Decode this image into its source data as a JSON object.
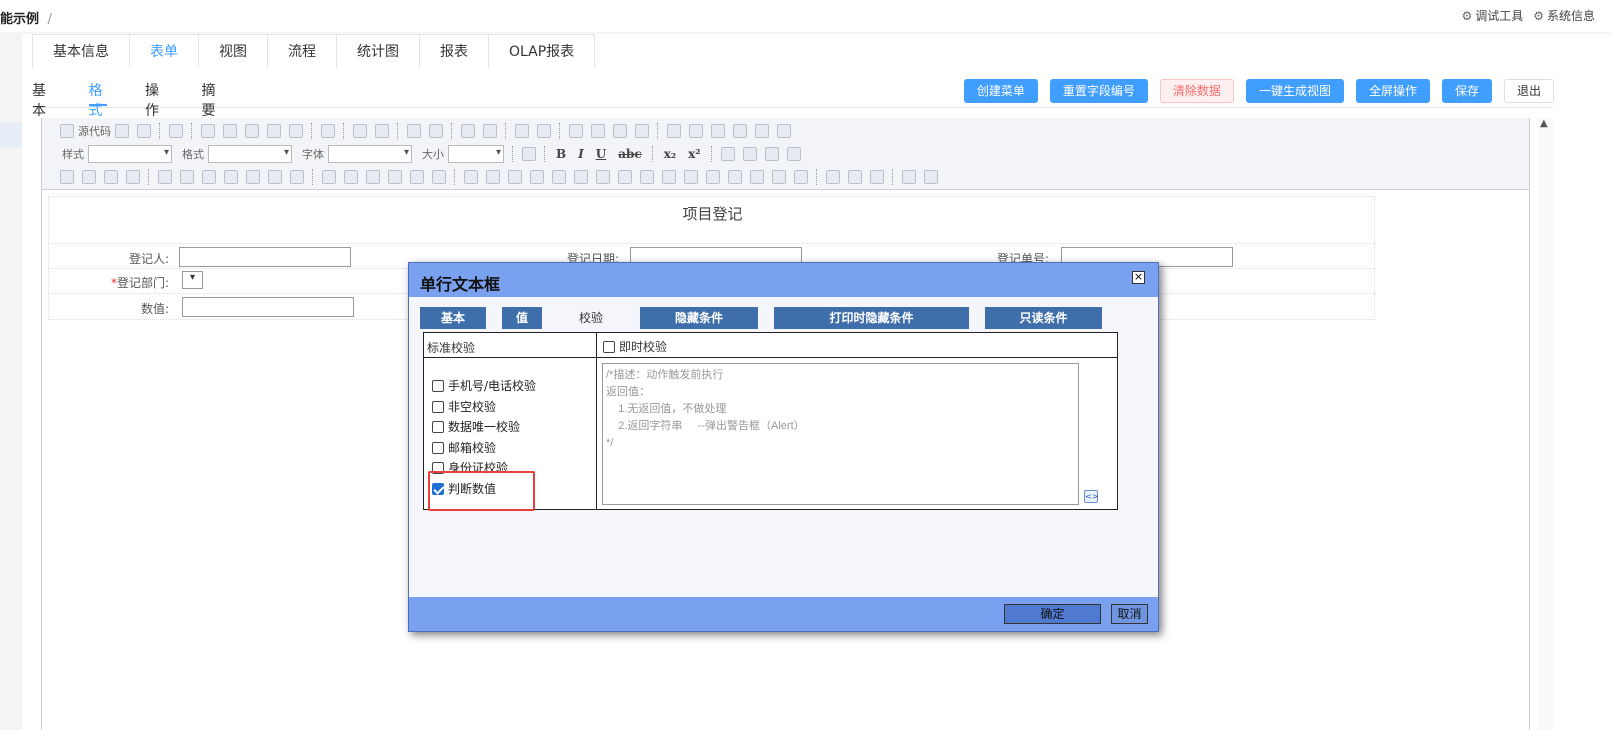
{
  "header": {
    "breadcrumb": "能示例",
    "breadcrumb_sep": "/",
    "debug_tool": "调试工具",
    "system_info": "系统信息"
  },
  "main_tabs": [
    "基本信息",
    "表单",
    "视图",
    "流程",
    "统计图",
    "报表",
    "OLAP报表"
  ],
  "main_tabs_active": "表单",
  "sub_tabs": [
    "基本",
    "格式",
    "操作",
    "摘要"
  ],
  "sub_tabs_active": "格式",
  "actions": {
    "create_menu": "创建菜单",
    "reset_field_no": "重置字段编号",
    "clear_data": "清除数据",
    "gen_view": "一键生成视图",
    "fullscreen": "全屏操作",
    "save": "保存",
    "exit": "退出"
  },
  "toolbar": {
    "source_code": "源代码",
    "style_label": "样式",
    "format_label": "格式",
    "font_label": "字体",
    "size_label": "大小"
  },
  "form": {
    "title": "项目登记",
    "registrant_label": "登记人:",
    "date_label": "登记日期:",
    "reg_no_label": "登记单号:",
    "dept_label": "登记部门:",
    "dept_required": "*",
    "value_label": "数值:"
  },
  "dialog": {
    "title": "单行文本框",
    "tabs": [
      "基本",
      "值",
      "校验",
      "隐藏条件",
      "打印时隐藏条件",
      "只读条件"
    ],
    "active_tab": "校验",
    "standard_validation": "标准校验",
    "instant_validation": "即时校验",
    "checks": [
      {
        "label": "手机号/电话校验",
        "checked": false
      },
      {
        "label": "非空校验",
        "checked": false
      },
      {
        "label": "数据唯一校验",
        "checked": false
      },
      {
        "label": "邮箱校验",
        "checked": false
      },
      {
        "label": "身份证校验",
        "checked": false
      },
      {
        "label": "判断数值",
        "checked": true
      }
    ],
    "code_placeholder": "/*描述：动作触发前执行\n返回值：\n    1.无返回值，不做处理\n    2.返回字符串     --弹出警告框（Alert）\n*/",
    "ok": "确定",
    "cancel": "取消"
  }
}
